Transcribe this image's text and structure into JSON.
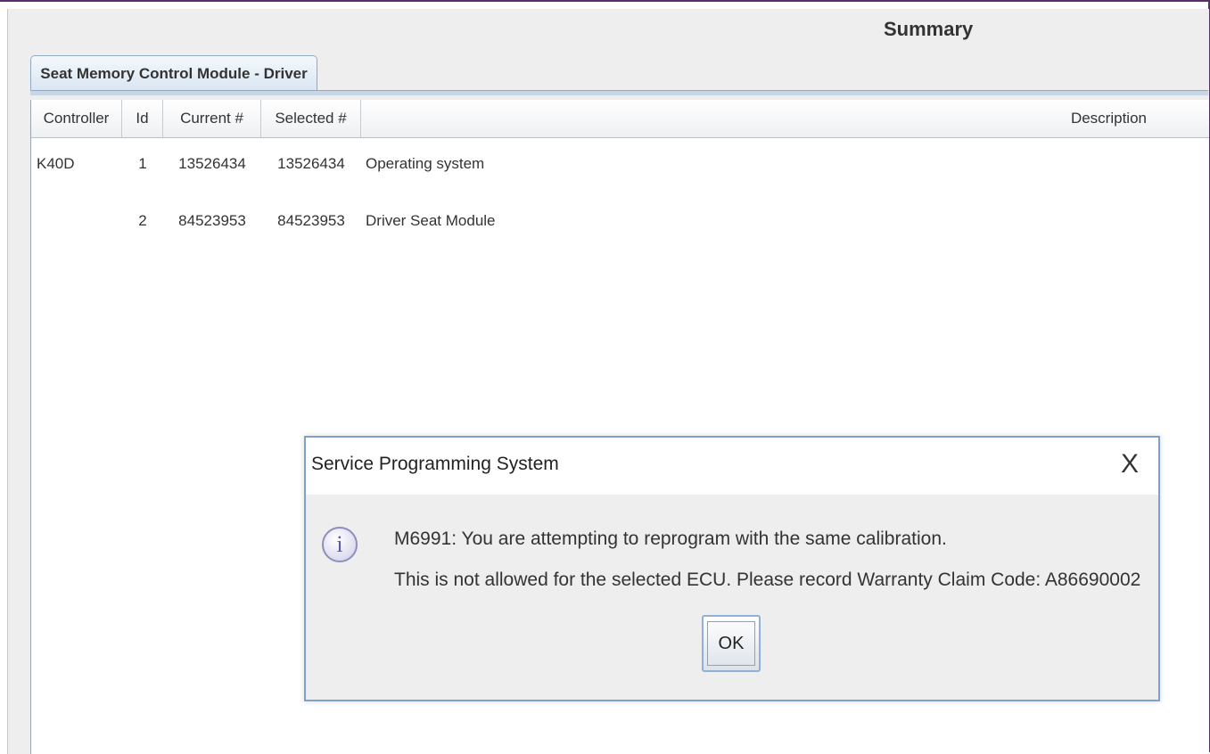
{
  "summary_title": "Summary",
  "tab": {
    "label": "Seat Memory Control Module - Driver"
  },
  "table": {
    "headers": [
      "Controller",
      "Id",
      "Current #",
      "Selected #",
      "Description"
    ],
    "rows": [
      [
        "K40D",
        "1",
        "13526434",
        "13526434",
        "Operating system"
      ],
      [
        "",
        "2",
        "84523953",
        "84523953",
        "Driver Seat Module"
      ]
    ]
  },
  "dialog": {
    "title": "Service Programming System",
    "close_glyph": "X",
    "icon": "info-icon",
    "icon_glyph": "i",
    "message_line1": "M6991: You are attempting to reprogram with the same calibration.",
    "message_line2": "This is not allowed for the selected ECU. Please record Warranty Claim Code: A86690002",
    "ok_label": "OK"
  },
  "colors": {
    "frame_border": "#5a2e6e",
    "tab_border": "#8fa9c7",
    "dialog_border": "#7f9fcf"
  }
}
